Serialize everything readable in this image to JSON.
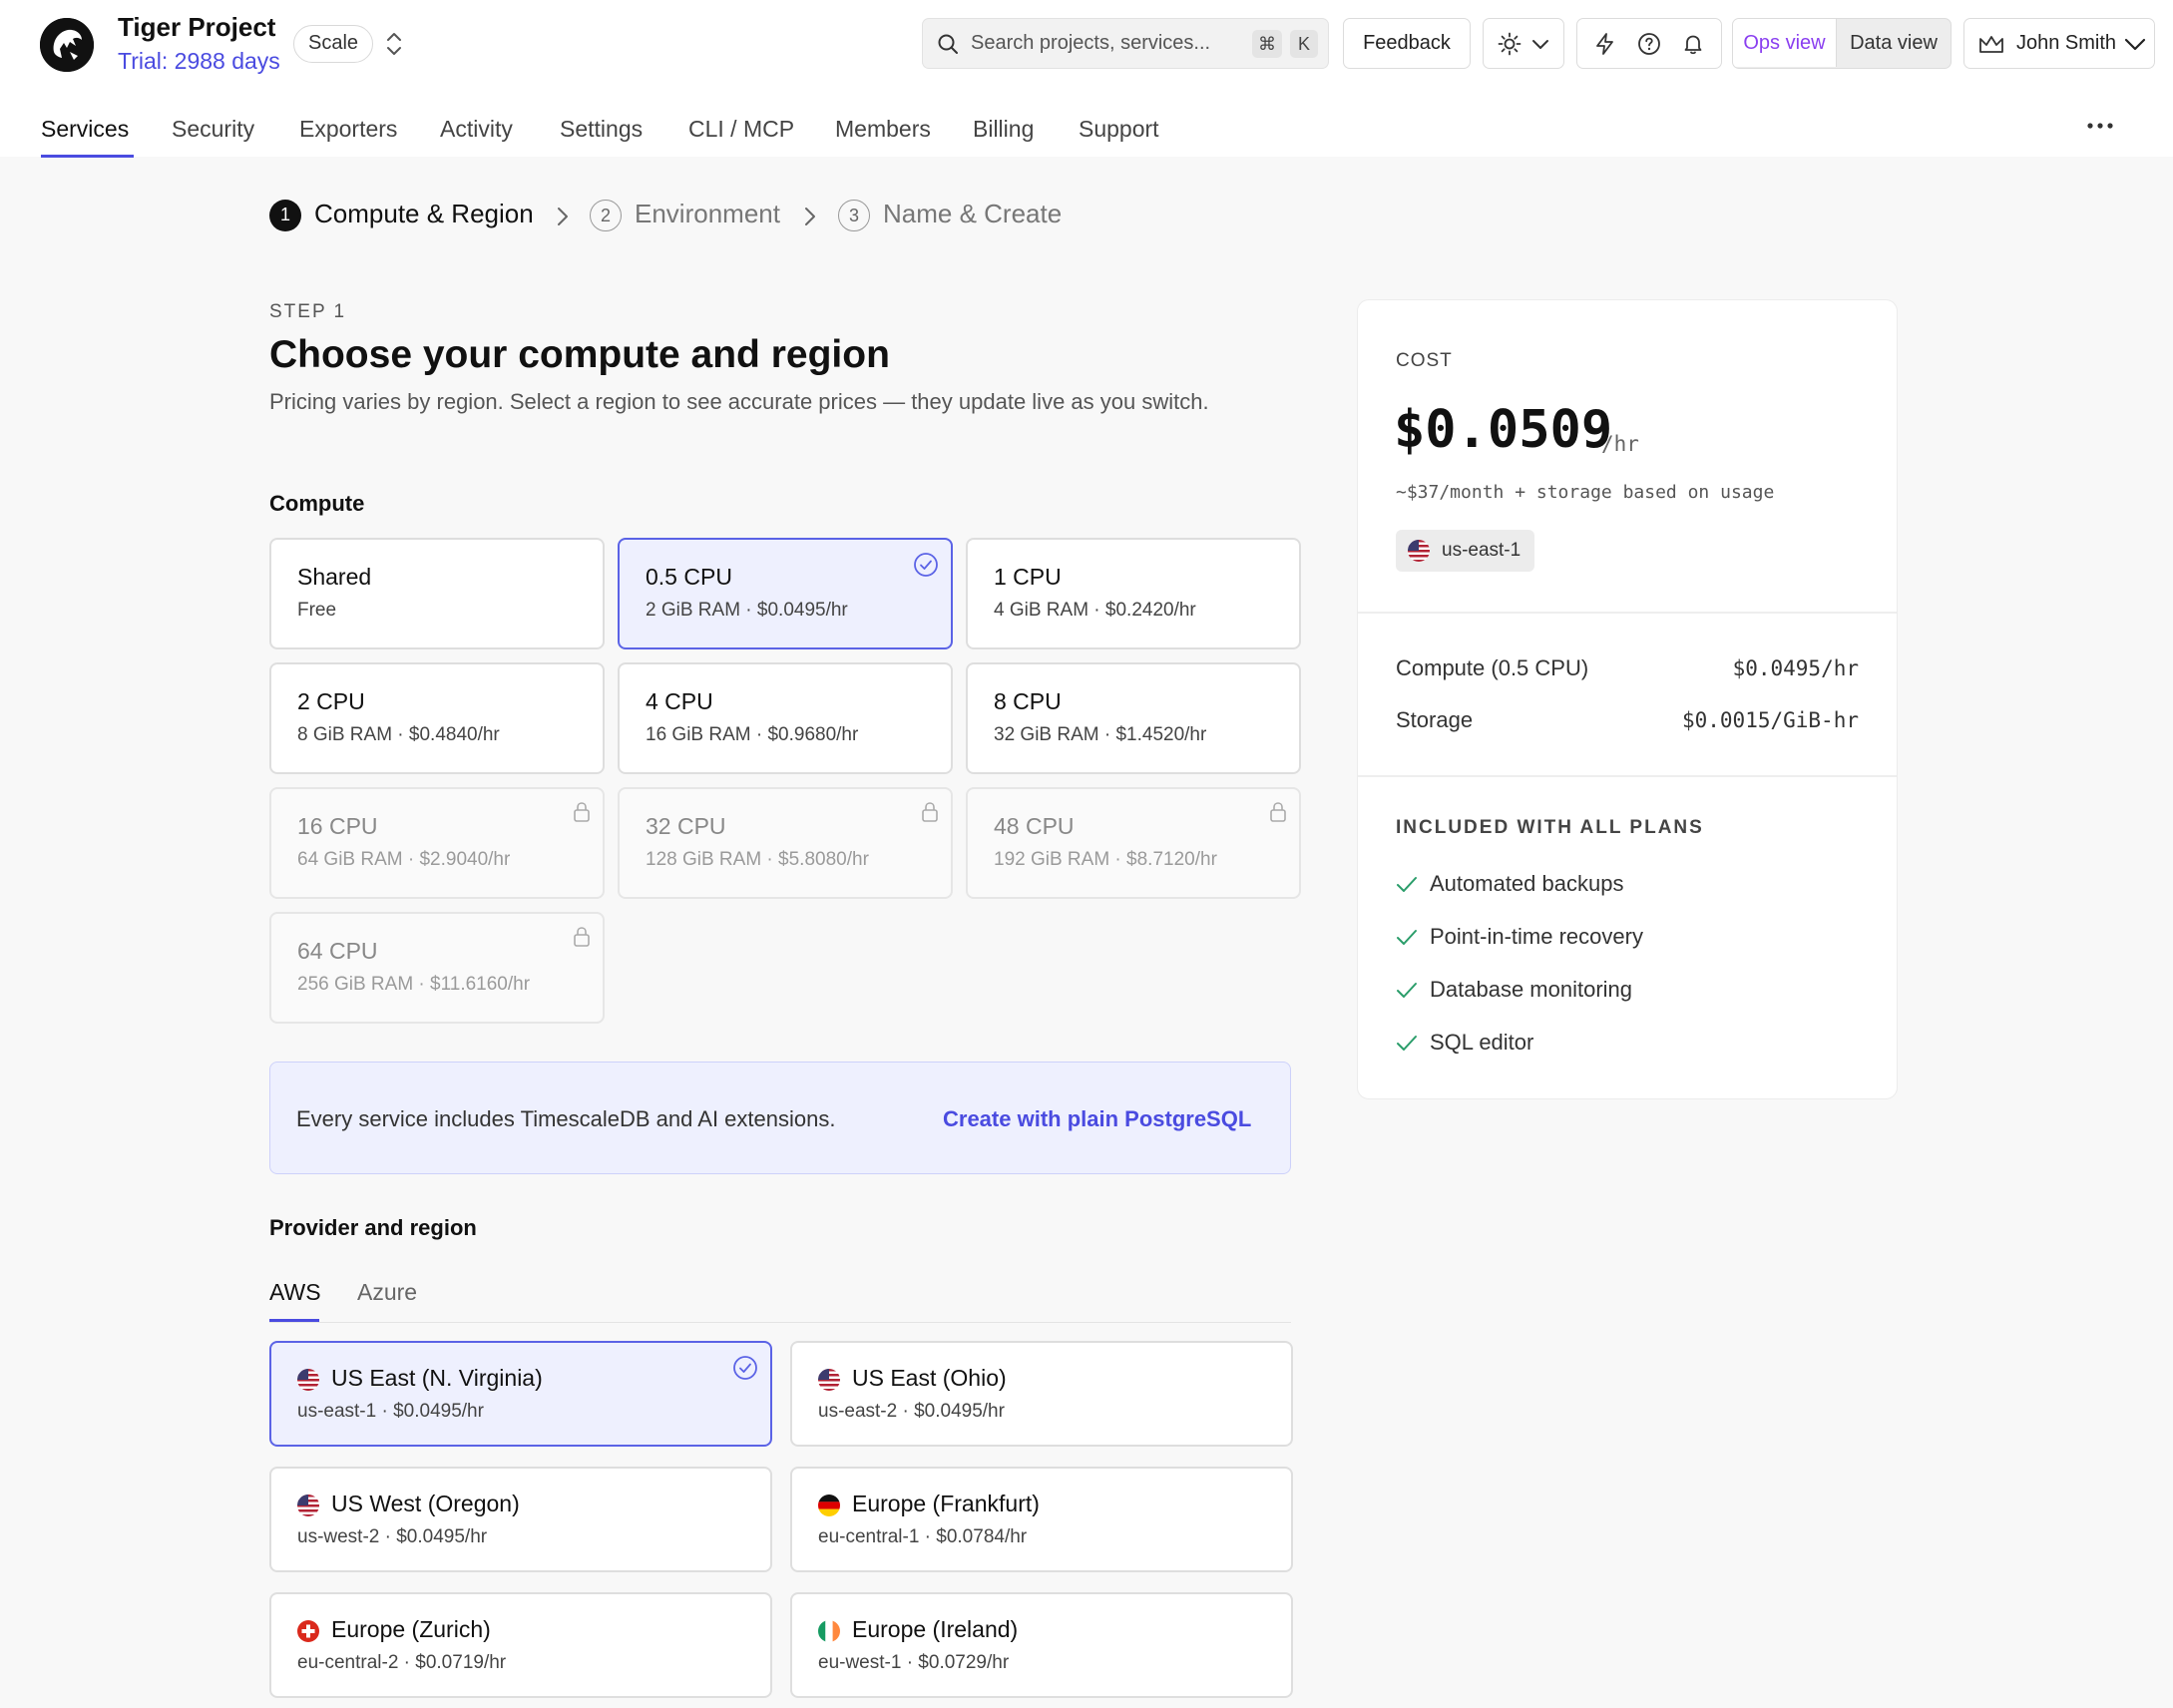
{
  "header": {
    "project_name": "Tiger Project",
    "trial": "Trial: 2988 days",
    "plan_badge": "Scale",
    "search_placeholder": "Search projects, services...",
    "shortcut_cmd": "⌘",
    "shortcut_key": "K",
    "feedback_label": "Feedback",
    "view_ops": "Ops view",
    "view_data": "Data view",
    "user_name": "John Smith",
    "icons": [
      "sun-icon",
      "chevron-down-icon",
      "lightning-icon",
      "help-icon",
      "bell-icon",
      "crown-icon",
      "more-icon"
    ]
  },
  "nav": {
    "items": [
      "Services",
      "Security",
      "Exporters",
      "Activity",
      "Settings",
      "CLI / MCP",
      "Members",
      "Billing",
      "Support"
    ],
    "active": "Services"
  },
  "stepper": {
    "steps": [
      {
        "number": "1",
        "label": "Compute & Region",
        "active": true
      },
      {
        "number": "2",
        "label": "Environment",
        "active": false
      },
      {
        "number": "3",
        "label": "Name & Create",
        "active": false
      }
    ]
  },
  "main": {
    "eyebrow": "STEP 1",
    "title": "Choose your compute and region",
    "description": "Pricing varies by region. Select a region to see accurate prices — they update live as you switch.",
    "compute_label": "Compute",
    "compute": [
      {
        "title": "Shared",
        "sub": "Free",
        "state": "normal"
      },
      {
        "title": "0.5 CPU",
        "sub": "2 GiB RAM · $0.0495/hr",
        "state": "selected"
      },
      {
        "title": "1 CPU",
        "sub": "4 GiB RAM · $0.2420/hr",
        "state": "normal"
      },
      {
        "title": "2 CPU",
        "sub": "8 GiB RAM · $0.4840/hr",
        "state": "normal"
      },
      {
        "title": "4 CPU",
        "sub": "16 GiB RAM · $0.9680/hr",
        "state": "normal"
      },
      {
        "title": "8 CPU",
        "sub": "32 GiB RAM · $1.4520/hr",
        "state": "normal"
      },
      {
        "title": "16 CPU",
        "sub": "64 GiB RAM · $2.9040/hr",
        "state": "locked"
      },
      {
        "title": "32 CPU",
        "sub": "128 GiB RAM · $5.8080/hr",
        "state": "locked"
      },
      {
        "title": "48 CPU",
        "sub": "192 GiB RAM · $8.7120/hr",
        "state": "locked"
      },
      {
        "title": "64 CPU",
        "sub": "256 GiB RAM · $11.6160/hr",
        "state": "locked"
      }
    ],
    "info_text": "Every service includes TimescaleDB and AI extensions.",
    "info_link": "Create with plain PostgreSQL",
    "provider_label": "Provider and region",
    "provider_tabs": [
      "AWS",
      "Azure"
    ],
    "active_provider": "AWS",
    "regions": [
      {
        "title": "US East (N. Virginia)",
        "sub": "us-east-1 · $0.0495/hr",
        "flag": "us",
        "selected": true
      },
      {
        "title": "US East (Ohio)",
        "sub": "us-east-2 · $0.0495/hr",
        "flag": "us",
        "selected": false
      },
      {
        "title": "US West (Oregon)",
        "sub": "us-west-2 · $0.0495/hr",
        "flag": "us",
        "selected": false
      },
      {
        "title": "Europe (Frankfurt)",
        "sub": "eu-central-1 · $0.0784/hr",
        "flag": "de",
        "selected": false
      },
      {
        "title": "Europe (Zurich)",
        "sub": "eu-central-2 · $0.0719/hr",
        "flag": "ch",
        "selected": false
      },
      {
        "title": "Europe (Ireland)",
        "sub": "eu-west-1 · $0.0729/hr",
        "flag": "ie",
        "selected": false
      }
    ]
  },
  "cost": {
    "label": "COST",
    "price": "$0.0509",
    "unit": "/hr",
    "monthly": "~$37/month + storage based on usage",
    "region": "us-east-1",
    "rows": [
      {
        "label": "Compute (0.5 CPU)",
        "value": "$0.0495/hr"
      },
      {
        "label": "Storage",
        "value": "$0.0015/GiB-hr"
      }
    ],
    "included_label": "INCLUDED WITH ALL PLANS",
    "features": [
      "Automated backups",
      "Point-in-time recovery",
      "Database monitoring",
      "SQL editor"
    ]
  },
  "colors": {
    "accent": "#4a4be0",
    "ops_view": "#8a3ff0",
    "selected_bg": "#eef0fe",
    "selected_border": "#5b63e6",
    "check_green": "#2a9d6a"
  }
}
